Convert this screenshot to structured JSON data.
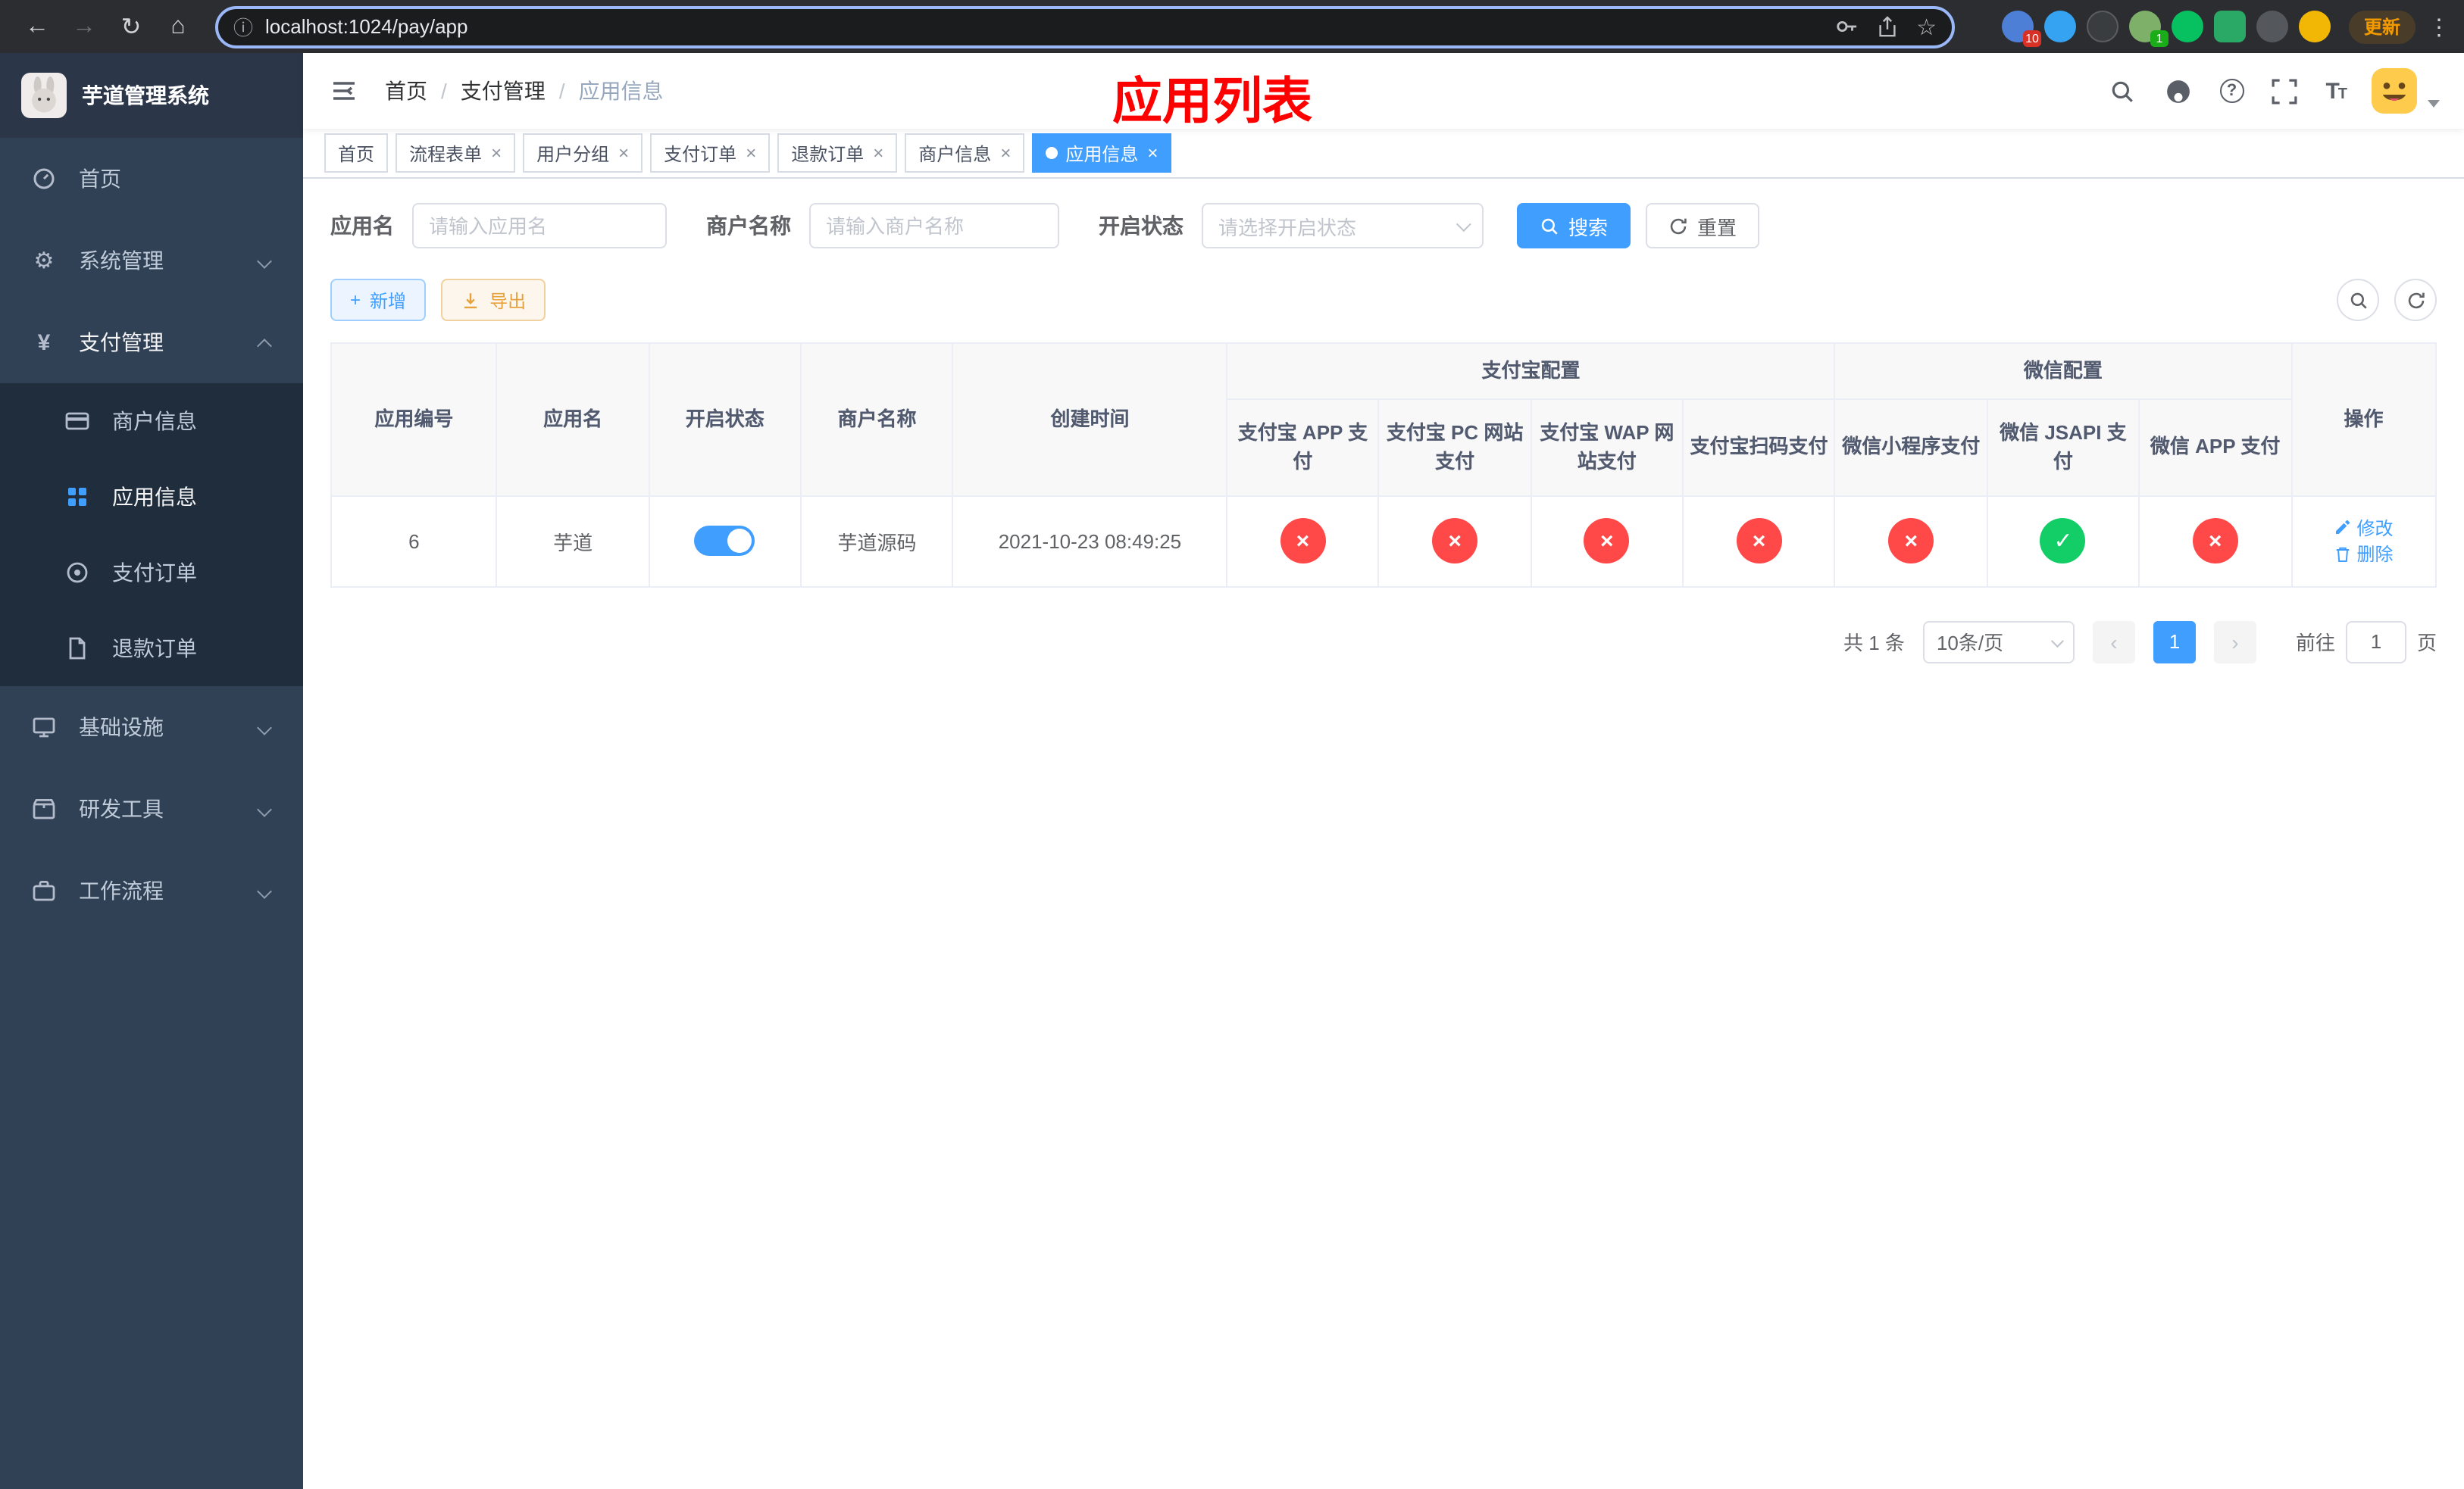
{
  "browser": {
    "url": "localhost:1024/pay/app",
    "update_button": "更新",
    "extension_badge_first": "10",
    "extension_badge_second": "1"
  },
  "colors": {
    "accent": "#409eff",
    "success": "#13ce66",
    "danger": "#ff4949",
    "warning": "#e6a23c",
    "sidebar_bg": "#304156",
    "submenu_bg": "#1f2d3d",
    "annotation_red": "#ff0000"
  },
  "sidebar": {
    "logo_title": "芋道管理系统",
    "items": {
      "home": "首页",
      "system": "系统管理",
      "payment": "支付管理",
      "merchant": "商户信息",
      "app": "应用信息",
      "pay_order": "支付订单",
      "refund_order": "退款订单",
      "infra": "基础设施",
      "dev_tools": "研发工具",
      "workflow": "工作流程"
    }
  },
  "navbar": {
    "breadcrumb": {
      "home": "首页",
      "payment": "支付管理",
      "app_info": "应用信息"
    },
    "overlay_title": "应用列表"
  },
  "tabs": {
    "home": "首页",
    "flow_form": "流程表单",
    "user_group": "用户分组",
    "pay_order": "支付订单",
    "refund_order": "退款订单",
    "merchant_info": "商户信息",
    "app_info": "应用信息"
  },
  "filters": {
    "app_name_label": "应用名",
    "app_name_placeholder": "请输入应用名",
    "merchant_name_label": "商户名称",
    "merchant_name_placeholder": "请输入商户名称",
    "status_label": "开启状态",
    "status_placeholder": "请选择开启状态",
    "search_button": "搜索",
    "reset_button": "重置"
  },
  "toolbar": {
    "add_button": "新增",
    "export_button": "导出"
  },
  "table": {
    "headers": {
      "app_id": "应用编号",
      "app_name": "应用名",
      "status": "开启状态",
      "merchant_name": "商户名称",
      "create_time": "创建时间",
      "alipay_group": "支付宝配置",
      "wechat_group": "微信配置",
      "alipay_app": "支付宝 APP 支付",
      "alipay_pc": "支付宝 PC 网站支付",
      "alipay_wap": "支付宝 WAP 网站支付",
      "alipay_qr": "支付宝扫码支付",
      "wechat_mini": "微信小程序支付",
      "wechat_jsapi": "微信 JSAPI 支付",
      "wechat_app": "微信 APP 支付",
      "actions": "操作"
    },
    "row": {
      "app_id": "6",
      "app_name": "芋道",
      "enabled": true,
      "merchant_name": "芋道源码",
      "create_time": "2021-10-23 08:49:25",
      "statuses": {
        "alipay_app": false,
        "alipay_pc": false,
        "alipay_wap": false,
        "alipay_qr": false,
        "wechat_mini": false,
        "wechat_jsapi": true,
        "wechat_app": false
      },
      "edit_link": "修改",
      "delete_link": "删除"
    }
  },
  "pagination": {
    "total": "共 1 条",
    "page_size": "10条/页",
    "current_page": "1",
    "goto_label": "前往",
    "goto_value": "1",
    "page_suffix": "页"
  }
}
